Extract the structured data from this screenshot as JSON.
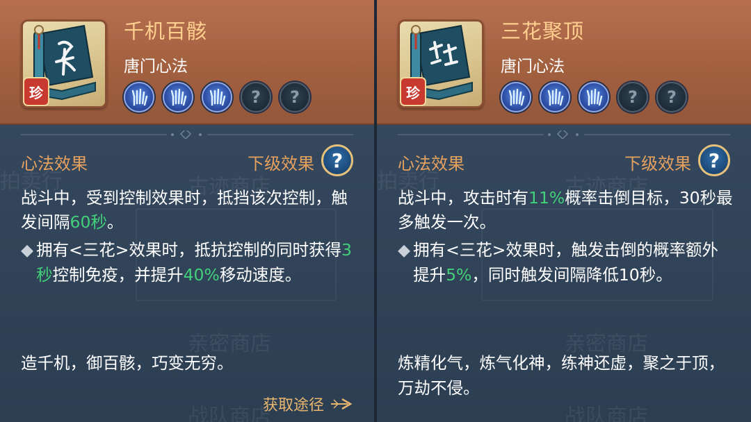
{
  "bg_ghost_labels": [
    "拍卖行",
    "古迹商店",
    "亲密商店",
    "战队商店"
  ],
  "cards": [
    {
      "title": "千机百骸",
      "category": "唐门心法",
      "rarity_badge": "珍",
      "skills": [
        "hand-skill-icon",
        "hand-skill-icon",
        "hand-skill-icon",
        "unknown-skill-icon",
        "unknown-skill-icon"
      ],
      "skill_unknown_glyph": "?",
      "effect_label": "心法效果",
      "lower_effect_label": "下级效果",
      "help_glyph": "?",
      "main_effect": {
        "t1": "战斗中，受到控制效果时，抵挡该次控制，触发间隔",
        "h1": "60秒",
        "t2": "。",
        "h2": "",
        "t3": ""
      },
      "bullet_mark": "◆",
      "bullet_effect": {
        "t1": "拥有<三花>效果时，抵抗控制的同时获得",
        "h1": "3秒",
        "t2": "控制免疫，并提升",
        "h2": "40%",
        "t3": "移动速度。"
      },
      "flavor": "造千机，御百骸，巧变无穷。",
      "acquire_label": "获取途径"
    },
    {
      "title": "三花聚顶",
      "category": "唐门心法",
      "rarity_badge": "珍",
      "skills": [
        "hand-skill-icon",
        "hand-skill-icon",
        "hand-skill-icon",
        "unknown-skill-icon",
        "unknown-skill-icon"
      ],
      "skill_unknown_glyph": "?",
      "effect_label": "心法效果",
      "lower_effect_label": "下级效果",
      "help_glyph": "?",
      "main_effect": {
        "t1": "战斗中，攻击时有",
        "h1": "11%",
        "t2": "概率击倒目标，30秒最多触发一次。",
        "h2": "",
        "t3": ""
      },
      "bullet_mark": "◆",
      "bullet_effect": {
        "t1": "拥有<三花>效果时，触发击倒的概率额外提升",
        "h1": "5%",
        "t2": "，同时触发间隔降低10秒。",
        "h2": "",
        "t3": ""
      },
      "flavor": "炼精化气，炼气化神，练神还虚，聚之于顶，万劫不侵。"
    }
  ],
  "colors": {
    "header": "#a2603f",
    "title": "#ffcf8f",
    "label": "#e7a15f",
    "highlight": "#42d07a",
    "body_text": "#ffffff",
    "panel": "#33465b"
  }
}
